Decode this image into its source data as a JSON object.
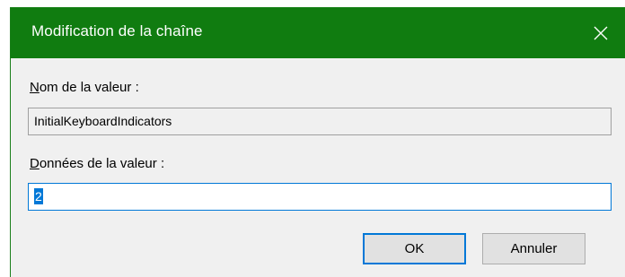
{
  "window": {
    "title": "Modification de la chaîne",
    "close_icon": "close-icon"
  },
  "value_name": {
    "label_access_key": "N",
    "label_rest": "om de la valeur :",
    "value": "InitialKeyboardIndicators"
  },
  "value_data": {
    "label_access_key": "D",
    "label_rest": "onnées de la valeur :",
    "value": "2"
  },
  "buttons": {
    "ok_label": "OK",
    "cancel_label": "Annuler"
  },
  "colors": {
    "titlebar": "#107c10",
    "accent": "#0078d7"
  }
}
